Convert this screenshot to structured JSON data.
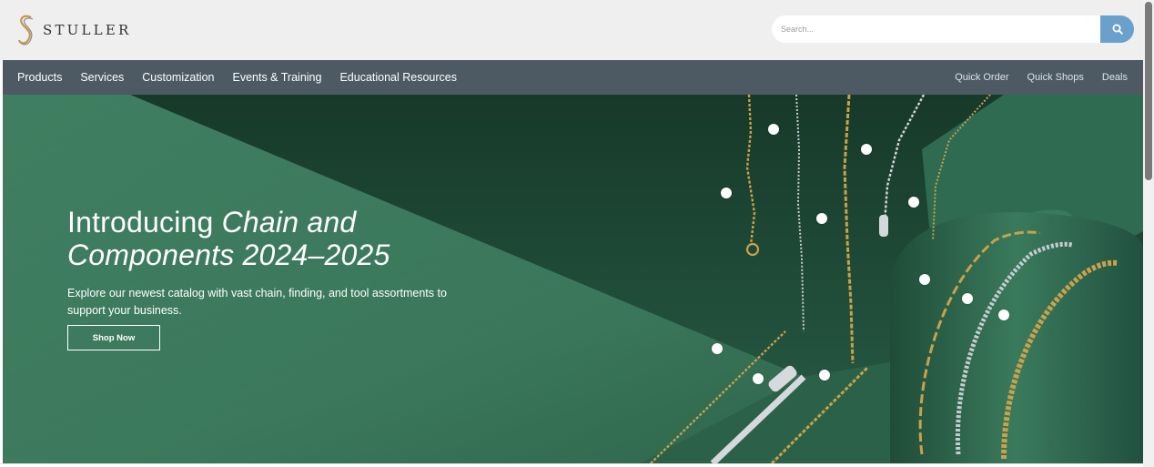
{
  "brand": {
    "name": "STULLER",
    "logo_icon": "stuller-s-logo"
  },
  "search": {
    "placeholder": "Search...",
    "button_icon": "search-icon",
    "button_color": "#6aa0cc"
  },
  "nav": {
    "primary": [
      {
        "label": "Products"
      },
      {
        "label": "Services"
      },
      {
        "label": "Customization"
      },
      {
        "label": "Events & Training"
      },
      {
        "label": "Educational Resources"
      }
    ],
    "utility": [
      {
        "label": "Quick Order"
      },
      {
        "label": "Quick Shops"
      },
      {
        "label": "Deals"
      }
    ],
    "bar_color": "#4d5a64"
  },
  "hero": {
    "title_plain": "Introducing ",
    "title_italic_1": "Chain and",
    "title_italic_2": "Components 2024–2025",
    "description": "Explore our newest catalog with vast chain, finding, and tool assortments to support your business.",
    "cta_label": "Shop Now",
    "background_color": "#2f6b50",
    "hotspot_count": 12
  },
  "colors": {
    "header_bg": "#efefef",
    "accent_gold": "#c9a24a",
    "silver": "#c8ccd0"
  }
}
